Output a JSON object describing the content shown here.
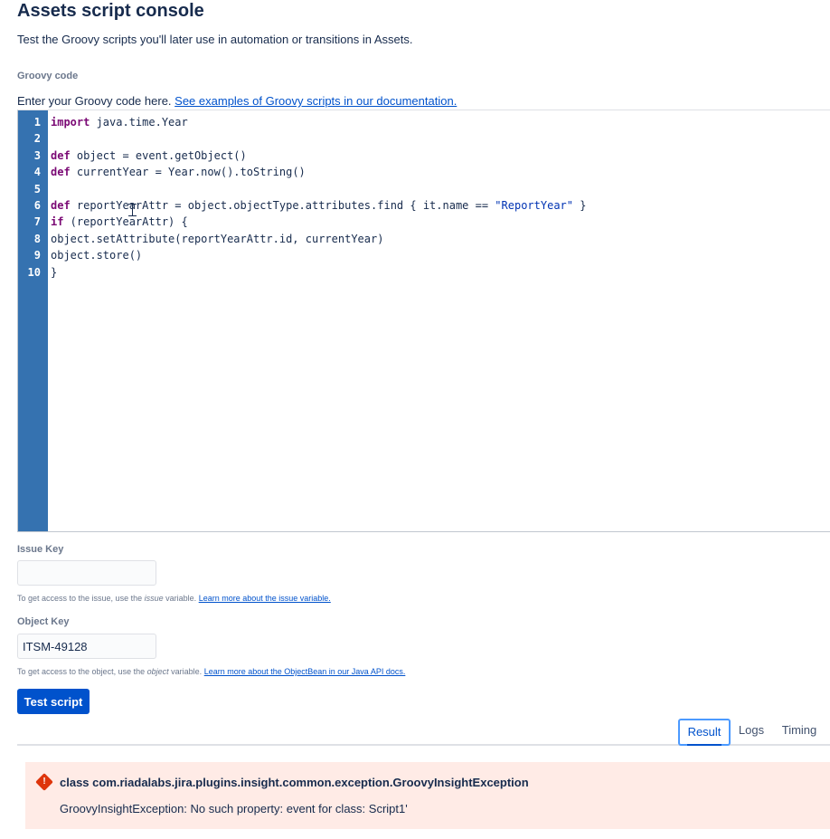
{
  "page": {
    "title": "Assets script console",
    "subtitle": "Test the Groovy scripts you'll later use in automation or transitions in Assets."
  },
  "code_section": {
    "label": "Groovy code",
    "help_text": "Enter your Groovy code here.",
    "help_link": "See examples of Groovy scripts in our documentation.",
    "lines": [
      {
        "no": "1",
        "text": "import java.time.Year"
      },
      {
        "no": "2",
        "text": ""
      },
      {
        "no": "3",
        "text": "def object = event.getObject()"
      },
      {
        "no": "4",
        "text": "def currentYear = Year.now().toString()"
      },
      {
        "no": "5",
        "text": ""
      },
      {
        "no": "6",
        "text": "def reportYearAttr = object.objectType.attributes.find { it.name == \"ReportYear\" }"
      },
      {
        "no": "7",
        "text": "if (reportYearAttr) {"
      },
      {
        "no": "8",
        "text": "object.setAttribute(reportYearAttr.id, currentYear)"
      },
      {
        "no": "9",
        "text": "object.store()"
      },
      {
        "no": "10",
        "text": "}"
      }
    ],
    "gutter_color": "#3572b0"
  },
  "issue_key": {
    "label": "Issue Key",
    "value": "",
    "hint_prefix": "To get access to the issue, use the",
    "hint_var": "issue",
    "hint_suffix": "variable.",
    "hint_link": "Learn more about the issue variable."
  },
  "object_key": {
    "label": "Object Key",
    "value": "ITSM-49128",
    "hint_prefix": "To get access to the object, use the",
    "hint_var": "object",
    "hint_suffix": "variable.",
    "hint_link": "Learn more about the ObjectBean in our Java API docs."
  },
  "actions": {
    "test_button": "Test script"
  },
  "tabs": {
    "result": "Result",
    "logs": "Logs",
    "timing": "Timing",
    "active": "Result"
  },
  "error": {
    "title": "class com.riadalabs.jira.plugins.insight.common.exception.GroovyInsightException",
    "message": "GroovyInsightException: No such property: event for class: Script1'",
    "icon": "error-icon",
    "color": "#de350b",
    "background": "#ffebe6"
  },
  "colors": {
    "primary": "#0052cc",
    "text": "#172b4d",
    "muted": "#6b778c"
  }
}
